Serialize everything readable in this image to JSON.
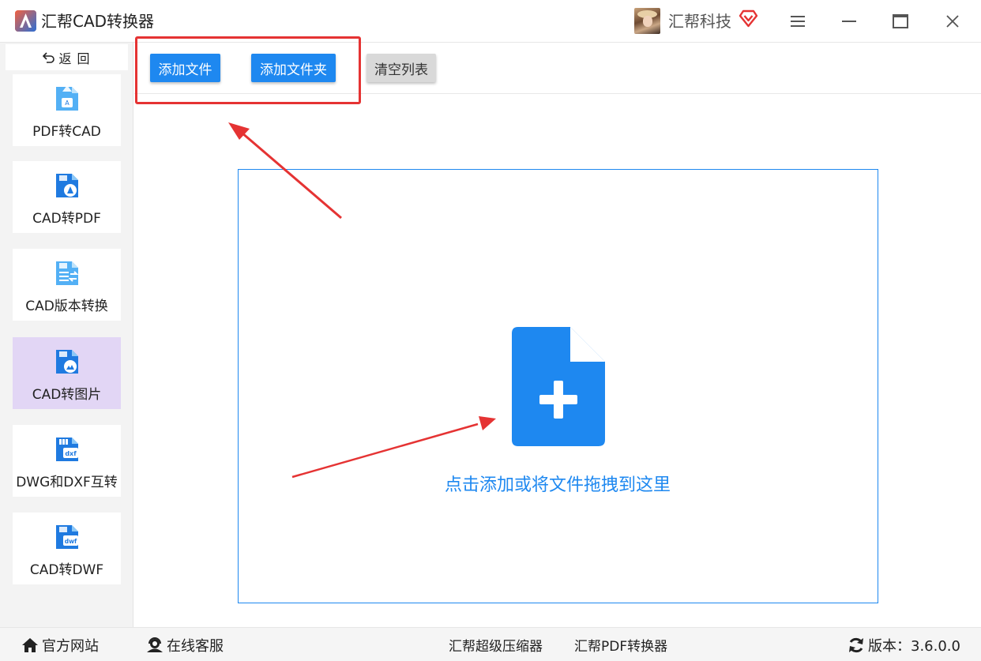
{
  "window": {
    "title": "汇帮CAD转换器",
    "company": "汇帮科技",
    "icons": [
      "app-logo-icon",
      "user-avatar",
      "vip-heart-icon",
      "menu-icon",
      "minimize-icon",
      "maximize-icon",
      "close-icon"
    ]
  },
  "sidebar": {
    "back_label": "返 回",
    "items": [
      {
        "label": "PDF转CAD",
        "icon": "pdf-to-cad-icon"
      },
      {
        "label": "CAD转PDF",
        "icon": "cad-to-pdf-icon"
      },
      {
        "label": "CAD版本转换",
        "icon": "cad-version-icon"
      },
      {
        "label": "CAD转图片",
        "icon": "cad-to-image-icon",
        "active": true
      },
      {
        "label": "DWG和DXF互转",
        "icon": "dwg-dxf-icon"
      },
      {
        "label": "CAD转DWF",
        "icon": "cad-to-dwf-icon"
      }
    ]
  },
  "toolbar": {
    "add_file": "添加文件",
    "add_folder": "添加文件夹",
    "clear_list": "清空列表"
  },
  "dropzone": {
    "hint": "点击添加或将文件拖拽到这里",
    "icon": "file-add-icon"
  },
  "statusbar": {
    "website": "官方网站",
    "service": "在线客服",
    "compressor": "汇帮超级压缩器",
    "pdf_converter": "汇帮PDF转换器",
    "version": "版本：3.6.0.0"
  },
  "colors": {
    "primary": "#1e88f0",
    "active_nav": "#e2d6f5",
    "annotation": "#e53333",
    "icon_dark": "#1f7ae0",
    "icon_light": "#53b0f5"
  }
}
